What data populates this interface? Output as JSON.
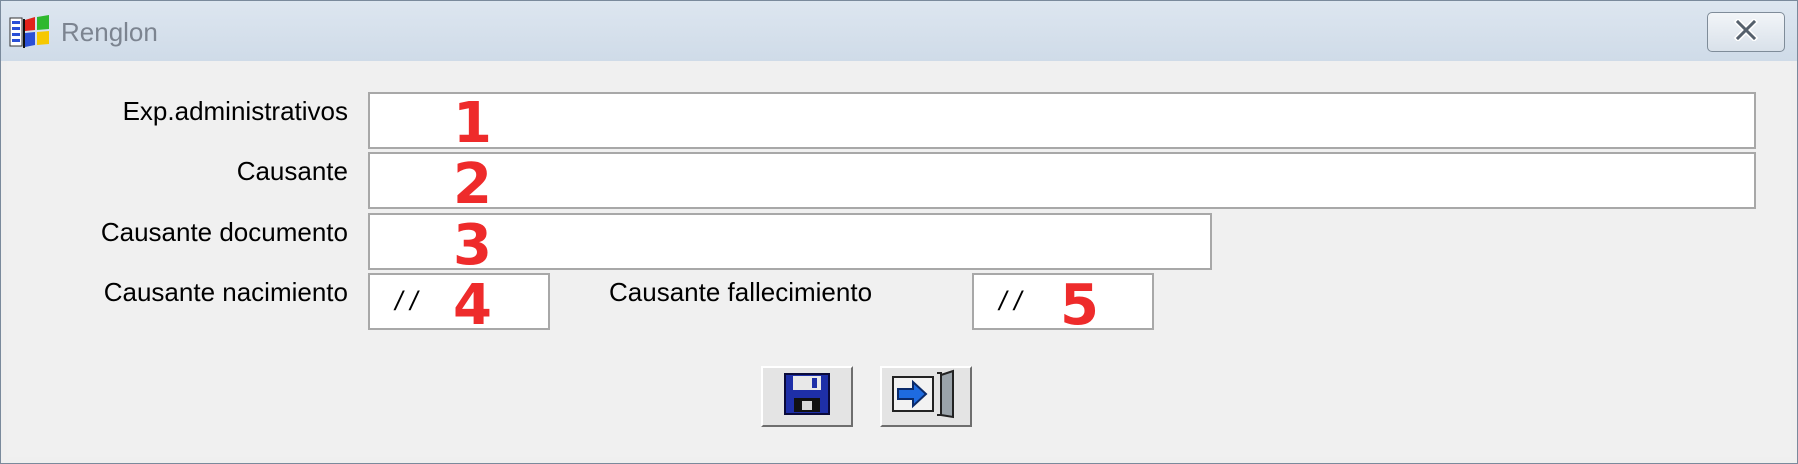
{
  "window": {
    "title": "Renglon",
    "icon": "windows-app-icon",
    "close_icon": "close-icon"
  },
  "form": {
    "exp_label": "Exp.administrativos",
    "exp_value": "",
    "causante_label": "Causante",
    "causante_value": "",
    "documento_label": "Causante documento",
    "documento_value": "",
    "nacimiento_label": "Causante nacimiento",
    "nacimiento_value": "/ /",
    "fallecimiento_label": "Causante fallecimiento",
    "fallecimiento_value": "/ /"
  },
  "markers": [
    "1",
    "2",
    "3",
    "4",
    "5"
  ],
  "toolbar": {
    "save_icon": "floppy-disk-icon",
    "exit_icon": "exit-door-icon"
  },
  "colors": {
    "marker": "#ee2b2b",
    "titlebar": "#dde6f0",
    "background": "#f0f0f0"
  }
}
